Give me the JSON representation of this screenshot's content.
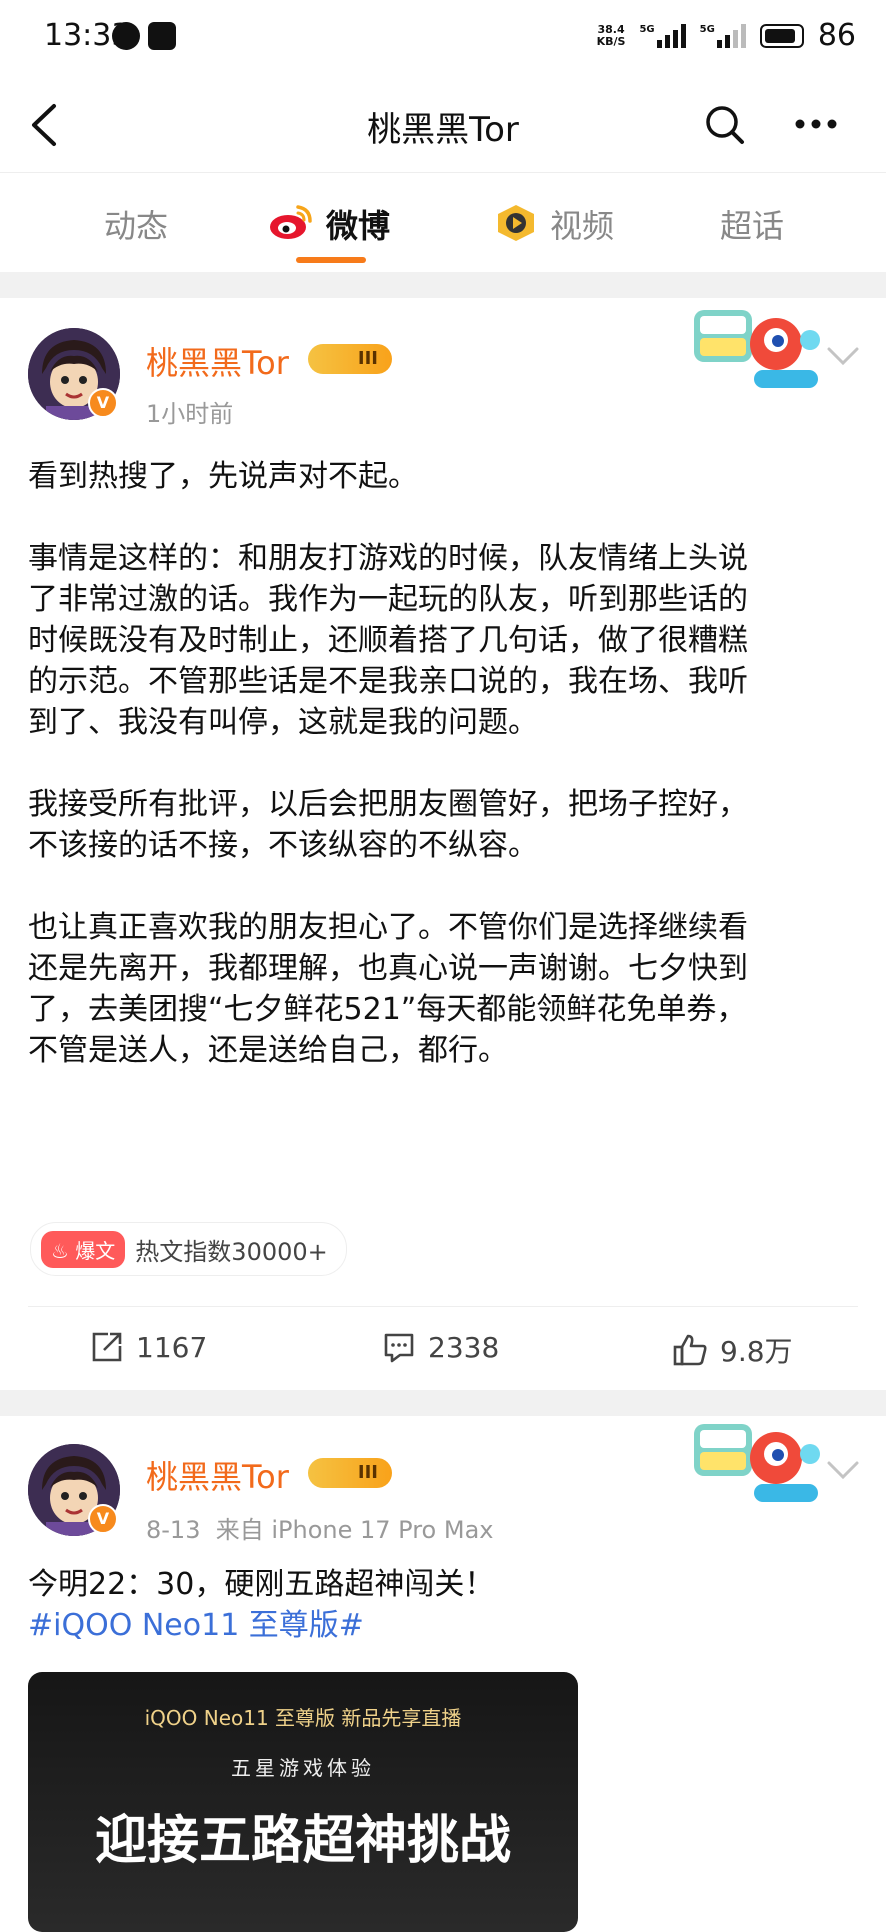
{
  "status_bar": {
    "time": "13:33",
    "speed": "38.4",
    "speed_unit": "KB/S",
    "battery": "86",
    "net1": "5G",
    "net2": "5G"
  },
  "header": {
    "title": "桃黑黑Tor"
  },
  "tabs": [
    {
      "label": "动态"
    },
    {
      "label": "微博"
    },
    {
      "label": "视频"
    },
    {
      "label": "超话"
    }
  ],
  "posts": [
    {
      "user": "桃黑黑Tor",
      "level": "III",
      "time": "1小时前",
      "paragraphs": [
        [
          "看到热搜了，先说声对不起。"
        ],
        [
          "事情是这样的：和朋友打游戏的时候，队友情绪上头说",
          "了非常过激的话。我作为一起玩的队友，听到那些话的",
          "时候既没有及时制止，还顺着搭了几句话，做了很糟糕",
          "的示范。不管那些话是不是我亲口说的，我在场、我听",
          "到了、我没有叫停，这就是我的问题。"
        ],
        [
          "我接受所有批评，以后会把朋友圈管好，把场子控好，",
          "不该接的话不接，不该纵容的不纵容。"
        ],
        [
          "也让真正喜欢我的朋友担心了。不管你们是选择继续看",
          "还是先离开，我都理解，也真心说一声谢谢。七夕快到",
          "了，去美团搜“七夕鲜花521”每天都能领鲜花免单券，",
          "不管是送人，还是送给自己，都行。"
        ]
      ],
      "hot_tag": "爆文",
      "hot_text": "热文指数30000+",
      "reposts": "1167",
      "comments": "2338",
      "likes": "9.8万"
    },
    {
      "user": "桃黑黑Tor",
      "level": "III",
      "time": "8-13",
      "source": "来自 iPhone 17 Pro Max",
      "text": "今明22：30，硬刚五路超神闯关！",
      "topic": "#iQOO Neo11 至尊版#",
      "promo_line1": "iQOO Neo11 至尊版  新品先享直播",
      "promo_line2": "五星游戏体验",
      "promo_line3": "迎接五路超神挑战"
    }
  ],
  "colors": {
    "accent": "#f77b1a",
    "username": "#f26a1b",
    "topic": "#3b6fd8"
  },
  "icons": [
    "back-icon",
    "search-icon",
    "more-icon",
    "weibo-icon",
    "video-icon",
    "share-icon",
    "comment-icon",
    "like-icon",
    "chevron-down-icon"
  ]
}
